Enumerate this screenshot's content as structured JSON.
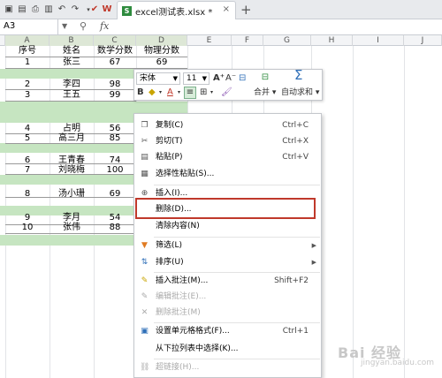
{
  "titlebar": {
    "file_tab": "excel测试表.xlsx *",
    "new_tab_icon": "plus-icon",
    "close_icon": "close-icon"
  },
  "formula_bar": {
    "name_box": "A3",
    "fx_label": "fx"
  },
  "columns": [
    "A",
    "B",
    "C",
    "D",
    "E",
    "F",
    "G",
    "H",
    "I",
    "J"
  ],
  "table": {
    "headers": [
      "序号",
      "姓名",
      "数学分数",
      "物理分数"
    ],
    "rows": [
      [
        "1",
        "张三",
        "67",
        "69"
      ],
      [
        "2",
        "李四",
        "98",
        ""
      ],
      [
        "3",
        "王五",
        "99",
        ""
      ],
      [
        "4",
        "占明",
        "56",
        ""
      ],
      [
        "5",
        "高三月",
        "85",
        ""
      ],
      [
        "6",
        "王青春",
        "74",
        ""
      ],
      [
        "7",
        "刘晓梅",
        "100",
        ""
      ],
      [
        "8",
        "汤小珊",
        "69",
        ""
      ],
      [
        "9",
        "李月",
        "54",
        ""
      ],
      [
        "10",
        "张伟",
        "88",
        ""
      ]
    ]
  },
  "mini_toolbar": {
    "font_name": "宋体",
    "font_size": "11",
    "merge_label": "合并",
    "autosum_label": "自动求和"
  },
  "context_menu": {
    "items": [
      {
        "label": "复制(C)",
        "shortcut": "Ctrl+C",
        "icon": "copy-icon"
      },
      {
        "label": "剪切(T)",
        "shortcut": "Ctrl+X",
        "icon": "scissors-icon"
      },
      {
        "label": "粘贴(P)",
        "shortcut": "Ctrl+V",
        "icon": "paste-icon"
      },
      {
        "label": "选择性粘贴(S)...",
        "shortcut": "",
        "icon": "paste-special-icon"
      },
      {
        "label": "插入(I)...",
        "shortcut": "",
        "icon": "insert-icon"
      },
      {
        "label": "删除(D)...",
        "shortcut": "",
        "icon": ""
      },
      {
        "label": "清除内容(N)",
        "shortcut": "",
        "icon": ""
      },
      {
        "label": "筛选(L)",
        "shortcut": "",
        "icon": "filter-icon"
      },
      {
        "label": "排序(U)",
        "shortcut": "",
        "icon": "sort-icon"
      },
      {
        "label": "插入批注(M)...",
        "shortcut": "Shift+F2",
        "icon": "comment-icon"
      },
      {
        "label": "编辑批注(E)...",
        "shortcut": "",
        "icon": "edit-comment-icon"
      },
      {
        "label": "删除批注(M)",
        "shortcut": "",
        "icon": "delete-comment-icon"
      },
      {
        "label": "设置单元格格式(F)...",
        "shortcut": "Ctrl+1",
        "icon": "format-cells-icon"
      },
      {
        "label": "从下拉列表中选择(K)...",
        "shortcut": "",
        "icon": ""
      },
      {
        "label": "超链接(H)...",
        "shortcut": "",
        "icon": "hyperlink-icon"
      }
    ]
  },
  "watermark": {
    "text": "Bai 经验",
    "sub": "jingyan.baidu.com"
  }
}
